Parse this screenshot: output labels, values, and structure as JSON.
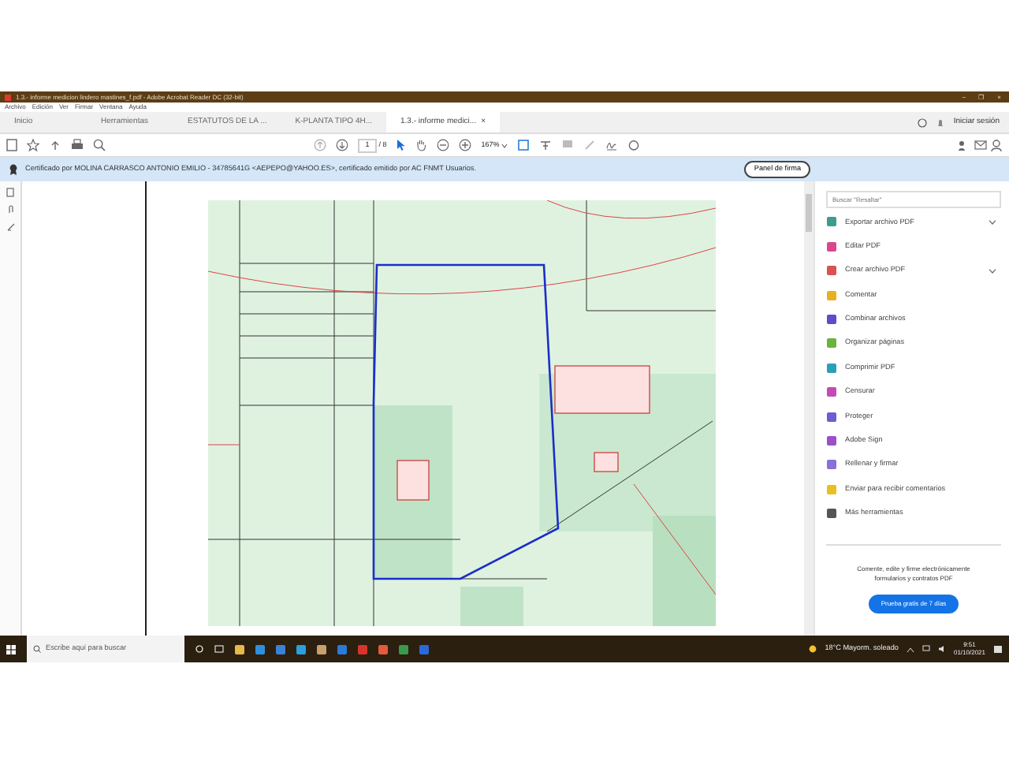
{
  "window": {
    "title": "1.3.- informe medicion lindero mastines_f.pdf - Adobe Acrobat Reader DC (32-bit)",
    "controls": [
      "−",
      "❐",
      "×"
    ]
  },
  "menu": [
    "Archivo",
    "Edición",
    "Ver",
    "Firmar",
    "Ventana",
    "Ayuda"
  ],
  "tabs": [
    {
      "label": "Inicio",
      "selected": false
    },
    {
      "label": "Herramientas",
      "selected": false
    },
    {
      "label": "ESTATUTOS DE LA ...",
      "selected": false
    },
    {
      "label": "K-PLANTA TIPO 4H...",
      "selected": false
    },
    {
      "label": "1.3.- informe medici...",
      "selected": true,
      "close": "×"
    }
  ],
  "account": {
    "label": "Iniciar sesión"
  },
  "toolbar": {
    "page": "1",
    "page_count": "/ 8",
    "zoom": "167%"
  },
  "signature_bar": {
    "text": "Certificado por MOLINA CARRASCO ANTONIO EMILIO - 34785641G <AEPEPO@YAHOO.ES>, certificado emitido por AC FNMT Usuarios.",
    "button": "Panel de firma"
  },
  "tools_panel": {
    "search_placeholder": "Buscar \"Resaltar\"",
    "items": [
      {
        "label": "Exportar archivo PDF",
        "color": "#3d9b8f",
        "expandable": true
      },
      {
        "label": "Editar PDF",
        "color": "#d9488a",
        "expandable": false
      },
      {
        "label": "Crear archivo PDF",
        "color": "#d9534f",
        "expandable": true
      },
      {
        "label": "Comentar",
        "color": "#e8b020",
        "expandable": false
      },
      {
        "label": "Combinar archivos",
        "color": "#5a4fc9",
        "expandable": false
      },
      {
        "label": "Organizar páginas",
        "color": "#6bb33b",
        "expandable": false
      },
      {
        "label": "Comprimir PDF",
        "color": "#2aa0b8",
        "expandable": false
      },
      {
        "label": "Censurar",
        "color": "#c44ab5",
        "expandable": false
      },
      {
        "label": "Proteger",
        "color": "#6a5fd0",
        "expandable": false
      },
      {
        "label": "Adobe Sign",
        "color": "#9b4fc9",
        "expandable": false
      },
      {
        "label": "Rellenar y firmar",
        "color": "#8a6fd8",
        "expandable": false
      },
      {
        "label": "Enviar para recibir comentarios",
        "color": "#e8c020",
        "expandable": false
      },
      {
        "label": "Más herramientas",
        "color": "#555555",
        "expandable": false
      }
    ],
    "promo": {
      "text": "Comente, edite y firme electrónicamente formularios y contratos PDF",
      "button": "Prueba gratis de 7 días"
    }
  },
  "taskbar": {
    "search_placeholder": "Escribe aquí para buscar",
    "weather": "18°C  Mayorm. soleado",
    "time": "9:51",
    "date": "01/10/2021"
  }
}
